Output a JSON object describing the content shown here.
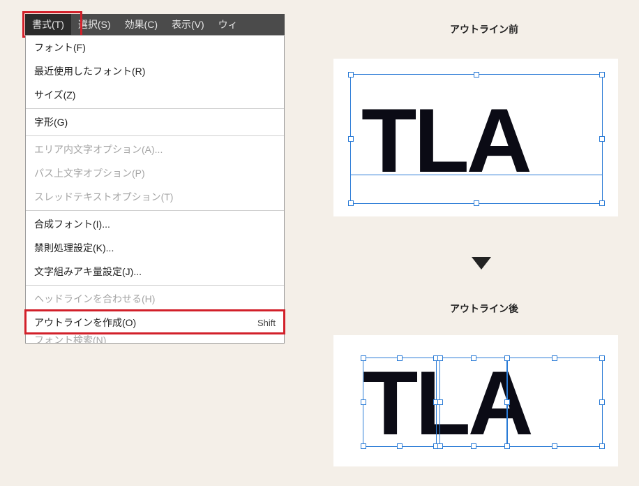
{
  "menubar": {
    "items": [
      {
        "label": "書式(T)",
        "active": true
      },
      {
        "label": "選択(S)"
      },
      {
        "label": "効果(C)"
      },
      {
        "label": "表示(V)"
      },
      {
        "label": "ウィ"
      }
    ]
  },
  "dropdown": {
    "groups": [
      [
        {
          "label": "フォント(F)"
        },
        {
          "label": "最近使用したフォント(R)"
        },
        {
          "label": "サイズ(Z)"
        }
      ],
      [
        {
          "label": "字形(G)"
        }
      ],
      [
        {
          "label": "エリア内文字オプション(A)...",
          "disabled": true
        },
        {
          "label": "パス上文字オプション(P)",
          "disabled": true
        },
        {
          "label": "スレッドテキストオプション(T)",
          "disabled": true
        }
      ],
      [
        {
          "label": "合成フォント(I)..."
        },
        {
          "label": "禁則処理設定(K)..."
        },
        {
          "label": "文字組みアキ量設定(J)..."
        }
      ],
      [
        {
          "label": "ヘッドラインを合わせる(H)",
          "disabled": true
        },
        {
          "label": "アウトラインを作成(O)",
          "shortcut": "Shift",
          "highlight": true
        },
        {
          "label": "フォント検索(N)",
          "cutoff": true
        }
      ]
    ]
  },
  "rightside": {
    "before_label": "アウトライン前",
    "after_label": "アウトライン後",
    "sample_text": "TLA"
  }
}
